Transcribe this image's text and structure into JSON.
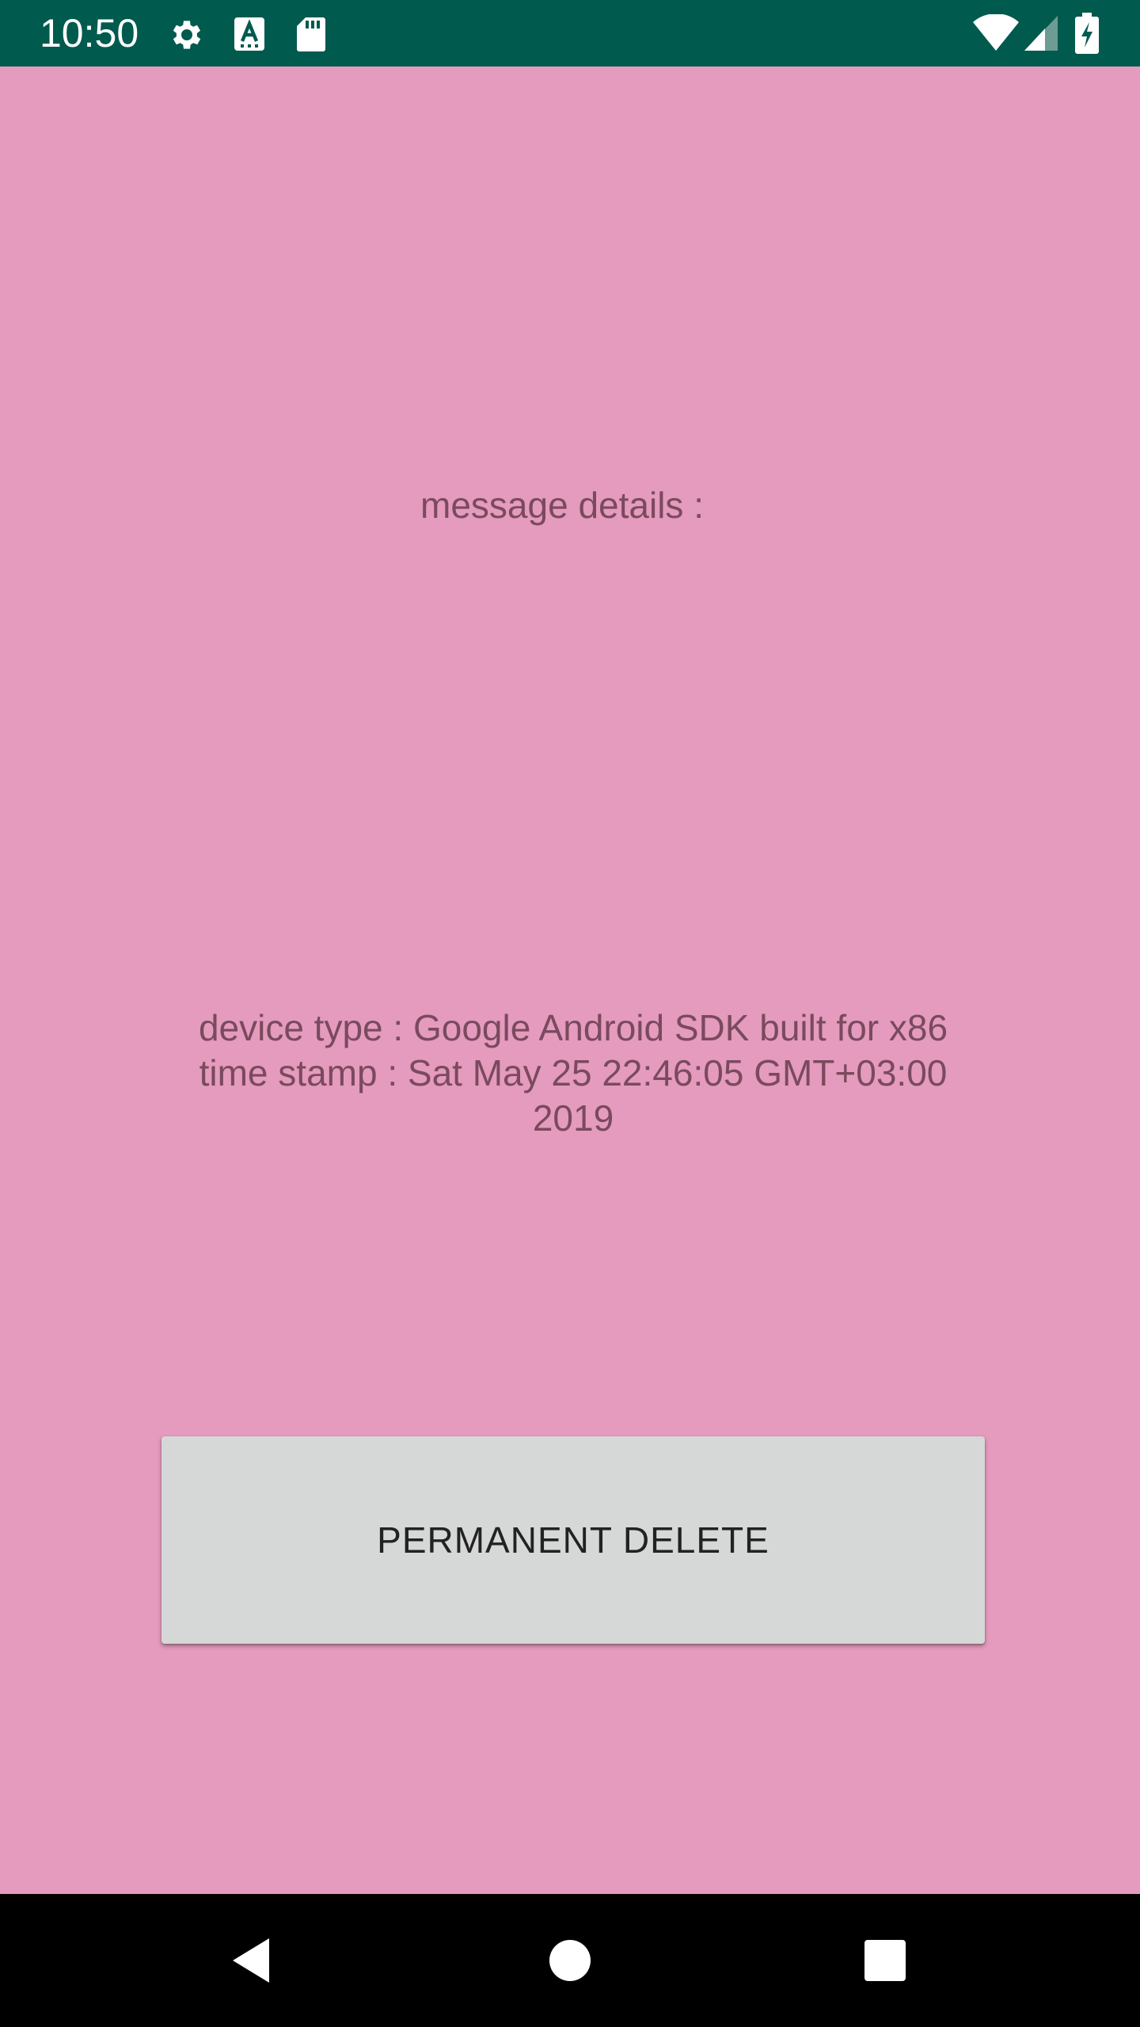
{
  "status_bar": {
    "time": "10:50",
    "background": "#005a4e",
    "icons_left": [
      "gear-icon",
      "keyboard-a-icon",
      "sd-card-icon"
    ],
    "icons_right": [
      "wifi-icon",
      "cell-signal-icon",
      "battery-charging-icon"
    ]
  },
  "screen": {
    "background": "#e59bbd",
    "message_label": "message details :",
    "device_line": "device type : Google Android SDK built for x86",
    "timestamp_line": "time stamp : Sat May 25 22:46:05 GMT+03:00 2019"
  },
  "actions": {
    "delete_label": "PERMANENT DELETE"
  },
  "nav_bar": {
    "buttons": [
      "back-icon",
      "home-icon",
      "recents-icon"
    ]
  }
}
